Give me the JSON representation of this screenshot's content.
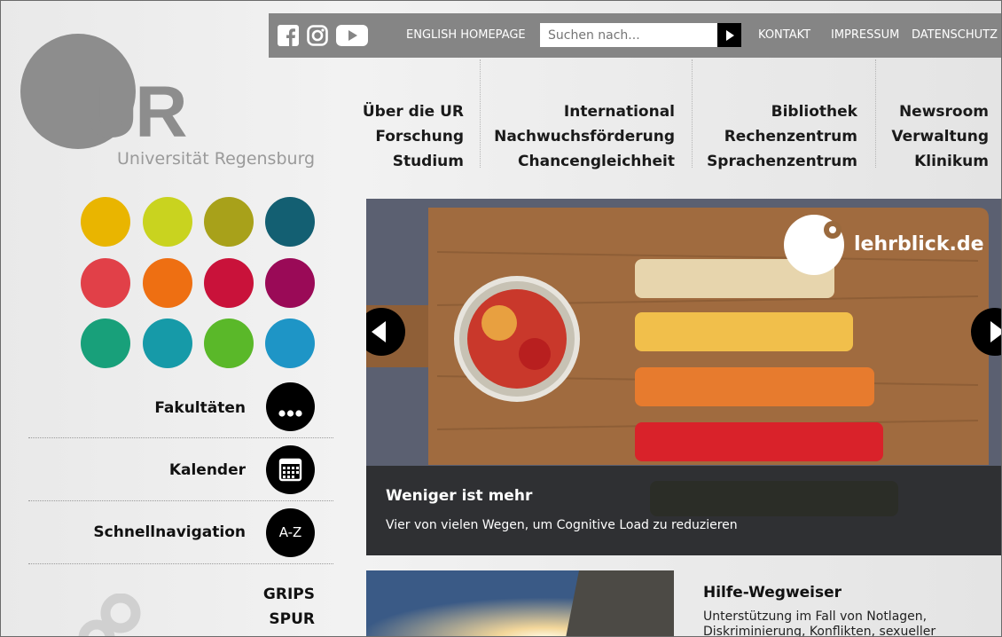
{
  "topbar": {
    "social": [
      "facebook-icon",
      "instagram-icon",
      "youtube-icon"
    ],
    "english_homepage": "ENGLISH HOMEPAGE",
    "search_placeholder": "Suchen nach...",
    "kontakt": "KONTAKT",
    "impressum": "IMPRESSUM",
    "datenschutz": "DATENSCHUTZ"
  },
  "logo": {
    "mark": "UR",
    "name": "Universität Regensburg"
  },
  "nav": {
    "col1": [
      "Über die UR",
      "Forschung",
      "Studium"
    ],
    "col2": [
      "International",
      "Nachwuchsförderung",
      "Chancengleichheit"
    ],
    "col3": [
      "Bibliothek",
      "Rechenzentrum",
      "Sprachenzentrum"
    ],
    "col4": [
      "Newsroom",
      "Verwaltung",
      "Klinikum"
    ]
  },
  "faculty_colors": [
    "#e9b500",
    "#c9d31f",
    "#a8a11a",
    "#135f72",
    "#e14048",
    "#ee6f12",
    "#c9123a",
    "#9a0a57",
    "#18a07a",
    "#169aa8",
    "#5ab829",
    "#1e95c6"
  ],
  "quicklinks": {
    "fakultaeten": "Fakultäten",
    "kalender": "Kalender",
    "schnellnavigation": "Schnellnavigation",
    "az": "A-Z"
  },
  "extra_links": [
    "GRIPS",
    "SPUR"
  ],
  "slider": {
    "brand": "lehrblick.de",
    "title": "Weniger ist mehr",
    "subtitle": "Vier von vielen Wegen, um Cognitive Load zu reduzieren"
  },
  "card": {
    "title": "Hilfe-Wegweiser",
    "text": "Unterstützung im Fall von Notlagen, Diskriminierung, Konflikten, sexueller"
  }
}
